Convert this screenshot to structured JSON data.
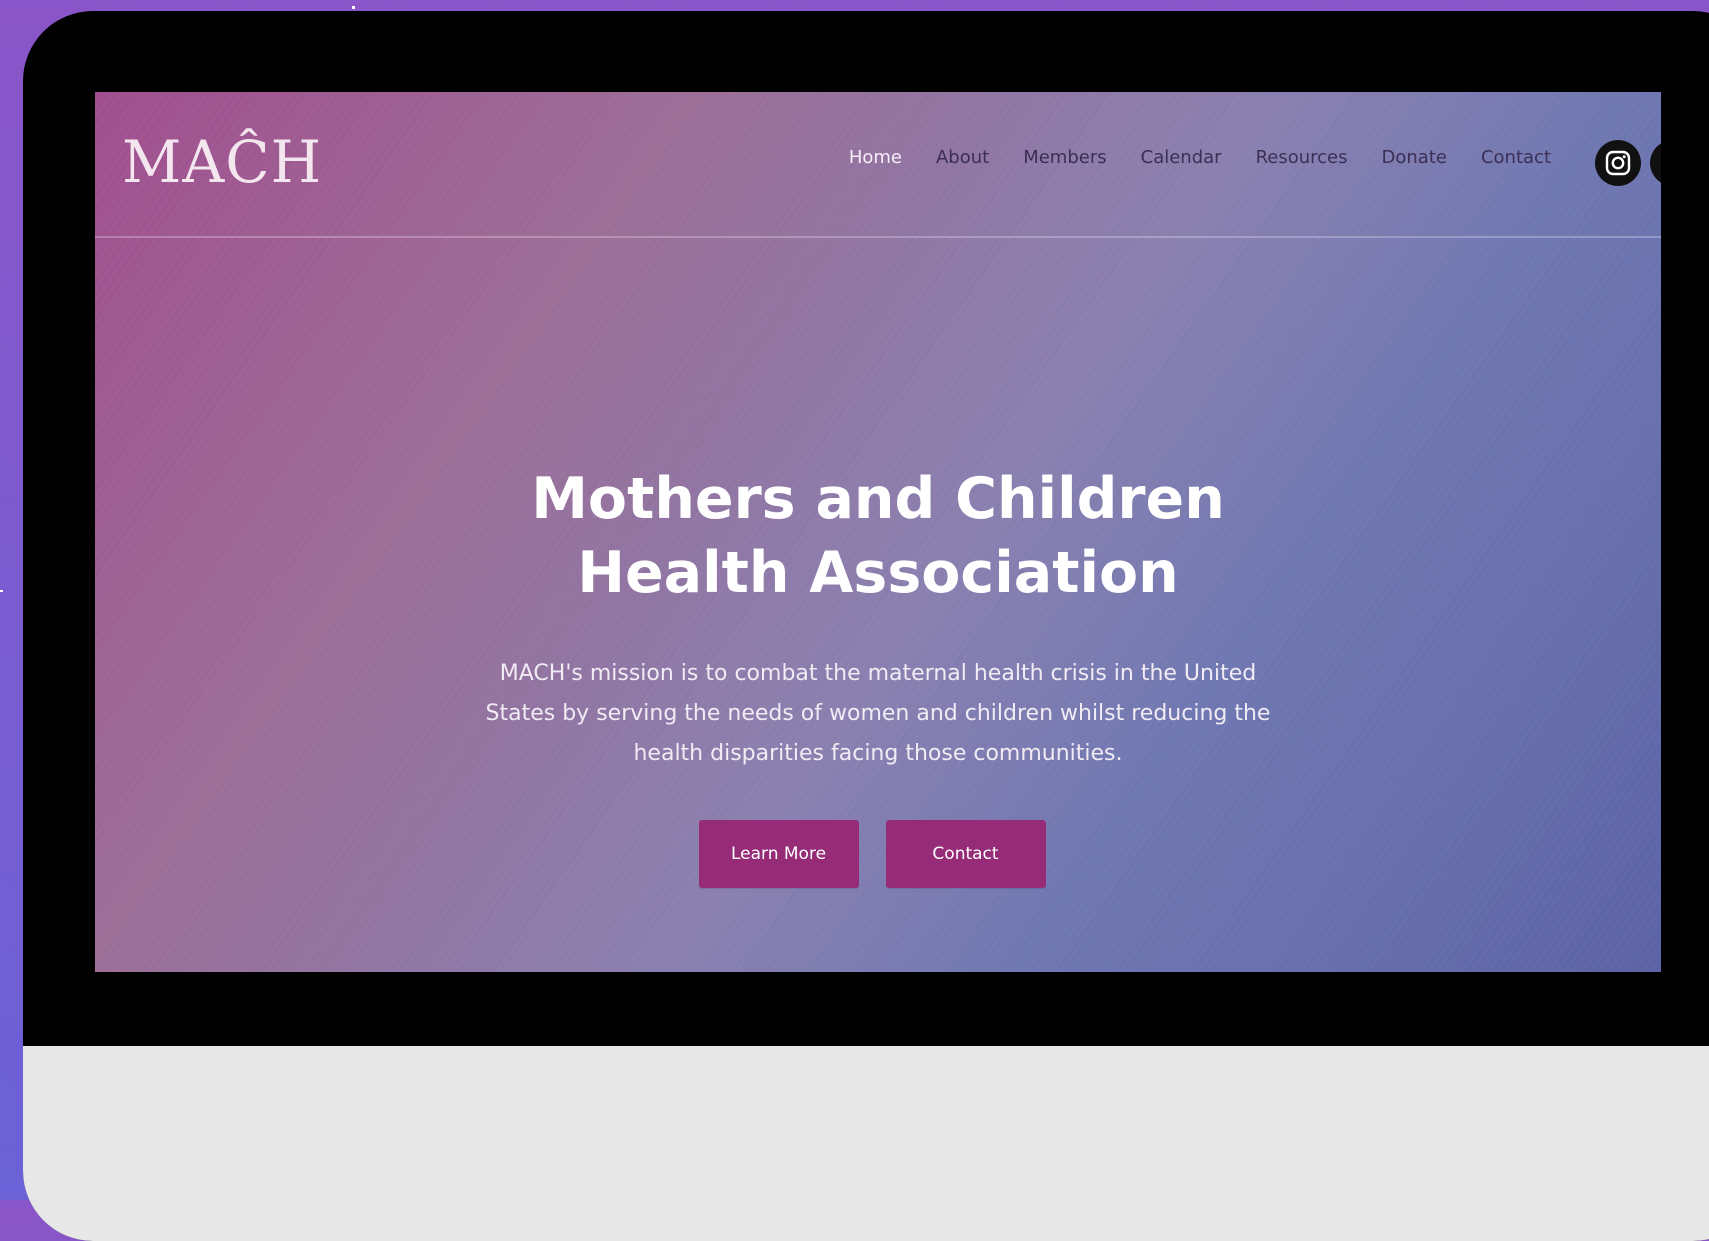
{
  "site": {
    "logo": "MAĈH",
    "nav": {
      "items": [
        "Home",
        "About",
        "Members",
        "Calendar",
        "Resources",
        "Donate",
        "Contact"
      ],
      "active": "Home"
    },
    "social": [
      "instagram-icon",
      "social-icon"
    ]
  },
  "hero": {
    "title_line1": "Mothers and Children",
    "title_line2": "Health Association",
    "mission": "MACH's mission is to combat the maternal health crisis in the United States by serving the needs of women and children whilst reducing the health disparities facing those communities.",
    "buttons": {
      "learn_more": "Learn More",
      "contact": "Contact"
    }
  },
  "colors": {
    "page_background": "#7a5cd0",
    "device_frame": "#000000",
    "device_chin": "#e7e7e8",
    "button": "#962c78",
    "hero_gradient_start": "#a04e8e",
    "hero_gradient_end": "#5c63a6"
  }
}
